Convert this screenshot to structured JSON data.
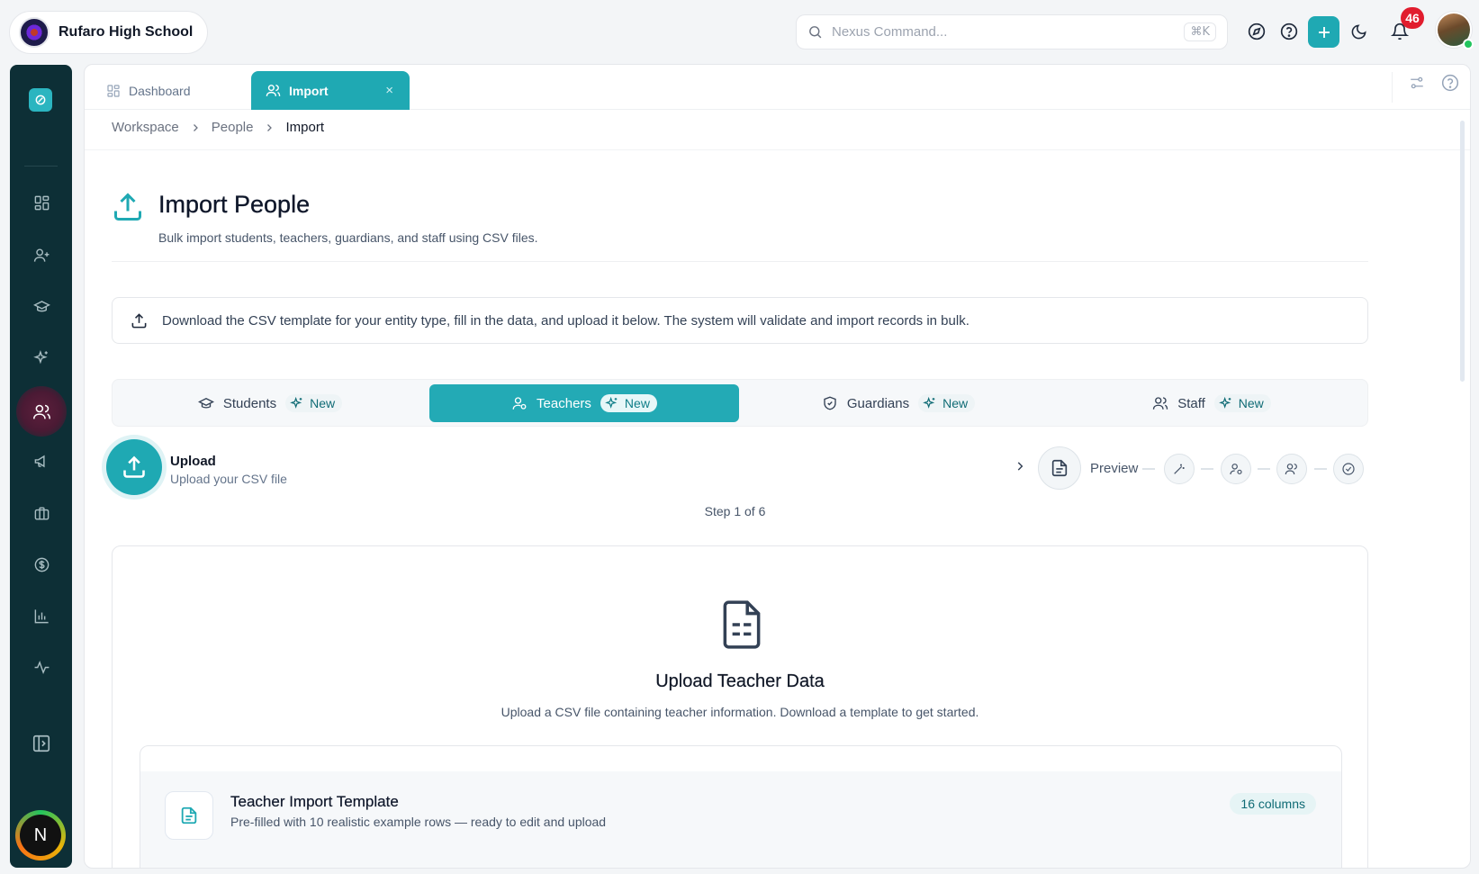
{
  "header": {
    "school_name": "Rufaro High School",
    "search_placeholder": "Nexus Command...",
    "search_shortcut": "⌘K",
    "notification_count": "46"
  },
  "sidebar": {
    "user_initial": "N",
    "active_item": "people"
  },
  "tabs": {
    "dashboard_label": "Dashboard",
    "import_label": "Import",
    "close_glyph": "×"
  },
  "breadcrumb": {
    "items": [
      "Workspace",
      "People",
      "Import"
    ]
  },
  "page": {
    "title": "Import People",
    "subtitle": "Bulk import students, teachers, guardians, and staff using CSV files.",
    "info_text": "Download the CSV template for your entity type, fill in the data, and upload it below. The system will validate and import records in bulk."
  },
  "entity_tabs": [
    {
      "label": "Students",
      "badge": "New"
    },
    {
      "label": "Teachers",
      "badge": "New",
      "active": true
    },
    {
      "label": "Guardians",
      "badge": "New"
    },
    {
      "label": "Staff",
      "badge": "New"
    }
  ],
  "stepper": {
    "current_title": "Upload",
    "current_sub": "Upload your CSV file",
    "next_label": "Preview",
    "step_count": "Step 1 of 6"
  },
  "upload_card": {
    "title": "Upload Teacher Data",
    "subtitle": "Upload a CSV file containing teacher information. Download a template to get started.",
    "template_title": "Teacher Import Template",
    "template_sub": "Pre-filled with 10 realistic example rows — ready to edit and upload",
    "columns_badge": "16 columns"
  },
  "colors": {
    "accent": "#1fa9b3",
    "sidebar_bg": "#0d2f36",
    "badge_red": "#e11d2e"
  }
}
